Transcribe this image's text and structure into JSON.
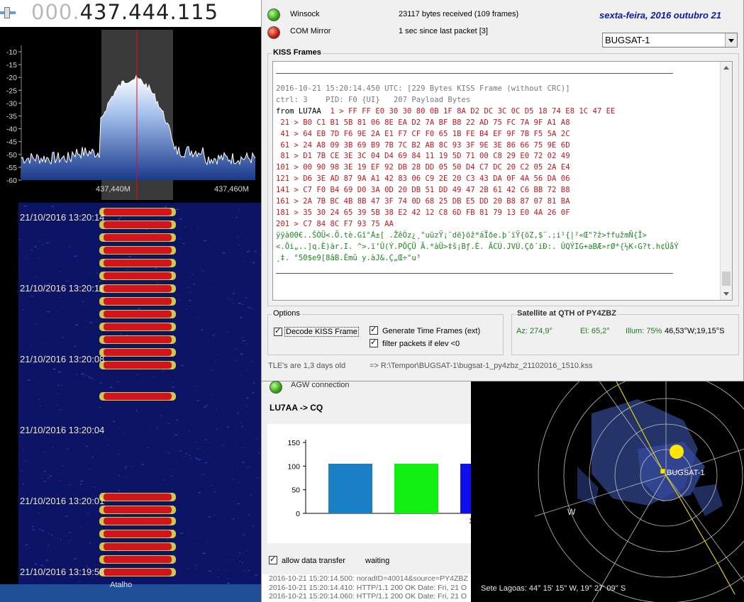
{
  "sdr": {
    "frequency_dim": "000.",
    "frequency_main": "437.444.115",
    "y_ticks": [
      "-10",
      "-15",
      "-20",
      "-25",
      "-30",
      "-35",
      "-40",
      "-45",
      "-50",
      "-55",
      "-60"
    ],
    "x_ticks": [
      "437,440M",
      "437,460M"
    ],
    "timestamps": [
      "21/10/2016 13:20:14",
      "21/10/2016 13:20:11",
      "21/10/2016 13:20:08",
      "21/10/2016 13:20:04",
      "21/10/2016 13:20:01",
      "21/10/2016 13:19:58"
    ],
    "taskbar_label": "Atalho",
    "accent_color": "#e21010"
  },
  "status": {
    "winsock_label": "Winsock",
    "winsock_info": "23117 bytes received (109 frames)",
    "com_label": "COM Mirror",
    "com_info": "1 sec since last packet [3]",
    "date": "sexta-feira, 2016 outubro 21",
    "satellite": "BUGSAT-1"
  },
  "kiss": {
    "title": "KISS Frames",
    "header_line": "2016-10-21 15:20:14.450 UTC: [229 Bytes KISS Frame (without CRC)]",
    "ctrl_line": "ctrl: 3    PID: F0 {UI}   207 Payload Bytes",
    "from_line": "from LU7AA",
    "hex_lines": [
      "  1 > FF FF E0 30 30 80 0B 1F 8A D2 DC 3C 0C D5 18 74 E8 1C 47 EE",
      " 21 > B0 C1 B1 5B 81 06 8E EA D2 7A BF B8 22 AD 75 FC 7A 9F A1 A8",
      " 41 > 64 EB 7D F6 9E 2A E1 F7 CF F0 65 1B FE B4 EF 9F 7B F5 5A 2C",
      " 61 > 24 A8 09 3B 69 B9 7B 7C B2 AB 8C 93 3F 9E 3E 86 66 75 9E 6D",
      " 81 > D1 7B CE 3E 3C 04 D4 69 84 11 19 5D 71 00 C8 29 E0 72 02 49",
      "101 > 00 90 98 3E 19 EF 92 DB 28 DD 05 50 D4 C7 DC 20 C2 05 2A E4",
      "121 > D6 3E AD 87 9A A1 42 83 06 C9 2E 20 C3 43 DA 0F 4A 56 DA 06",
      "141 > C7 F0 B4 69 D0 3A 0D 20 DB 51 DD 49 47 2B 61 42 C6 BB 72 B8",
      "161 > 2A 7B BC 4B 8B 47 3F 74 0D 68 25 DB E5 DD 20 B8 87 07 81 BA",
      "181 > 35 30 24 65 39 5B 38 E2 42 12 C8 6D FB 81 79 13 E0 4A 26 0F",
      "201 > C7 84 8C F7 93 75 AA"
    ],
    "ascii_lines": [
      "ÿÿà00€..ŠÒÜ<.Õ.tè.Gî°Á±[ .ŽêÒz¿¸\"uüzŸ¡¨dë}öž*áÏðe.þ´ïŸ{õZ,$¨.;i¹{|²«Œ\"?ž>†fužmÑ{Î>",
      "<.Öi„..]q.È)àr.I. ^>.ï’Û(Ý.PÕÇÜ Ã.*àÜ>‡š¡Bƒ.È. ÃCÚ.JVÚ.Çð´iÐ:. ÛQÝIG+aBÆ»rØ*{½K‹G?t.h¢ÛåÝ",
      "¸‡. °50$e9[8âB.Èmû y.àJ&.Ç„Œ÷\"u³"
    ]
  },
  "options": {
    "title": "Options",
    "decode_kiss": "Decode KISS Frame",
    "generate_time": "Generate Time Frames (ext)",
    "filter_packets": "filter packets if elev <0"
  },
  "satellite_qth": {
    "title": "Satellite at QTH of PY4ZBZ",
    "az": "Az: 274,9°",
    "el": "El: 65,2°",
    "illum": "Illum: 75%",
    "coords": "46,53°W;19,15°S"
  },
  "footer": {
    "tle_age": "TLE's are 1,3 days old",
    "file_path": "=> R:\\Tempor\\BUGSAT-1\\bugsat-1_py4zbz_21102016_1510.kss"
  },
  "agw": {
    "connection_label": "AGW connection",
    "route": "LU7AA -> CQ",
    "allow_transfer": "allow data transfer",
    "transfer_status": "waiting",
    "log_lines": [
      "2016-10-21 15:20:14.500: noradID=40014&source=PY4ZBZ",
      "2016-10-21 15:20:14.410: HTTP/1.1 200 OK Date: Fri, 21 O",
      "2016-10-21 15:20:14.060: HTTP/1.1 200 OK Date: Fri, 21 O"
    ]
  },
  "chart_data": {
    "type": "bar",
    "categories": [
      "",
      "",
      "1"
    ],
    "values": [
      105,
      105,
      105
    ],
    "colors": [
      "#1a7fc4",
      "#11ee11",
      "#1010ee"
    ],
    "y_ticks": [
      "150",
      "100",
      "50",
      "0"
    ],
    "ylim": [
      0,
      150
    ]
  },
  "skymap": {
    "satellite_label": "BUGSAT-1",
    "west_label": "W",
    "caption": "Sete Lagoas: 44° 15' 15'' W, 19° 27' 09'' S"
  }
}
